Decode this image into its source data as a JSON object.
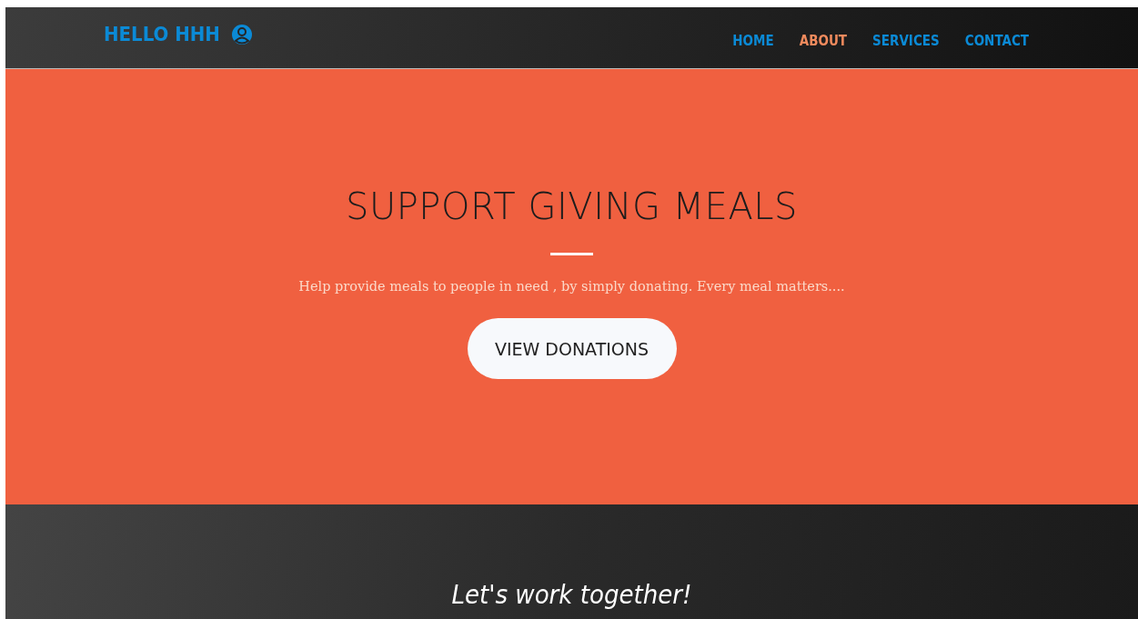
{
  "navbar": {
    "brand": "HELLO HHH",
    "links": [
      {
        "label": "HOME",
        "selected": false
      },
      {
        "label": "ABOUT",
        "selected": true
      },
      {
        "label": "SERVICES",
        "selected": false
      },
      {
        "label": "CONTACT",
        "selected": false
      }
    ]
  },
  "hero": {
    "title": "SUPPORT GIVING MEALS",
    "subtitle": "Help provide meals to people in need , by simply donating. Every meal matters....",
    "button": "VIEW DONATIONS"
  },
  "section": {
    "heading": "Let's work together!"
  }
}
